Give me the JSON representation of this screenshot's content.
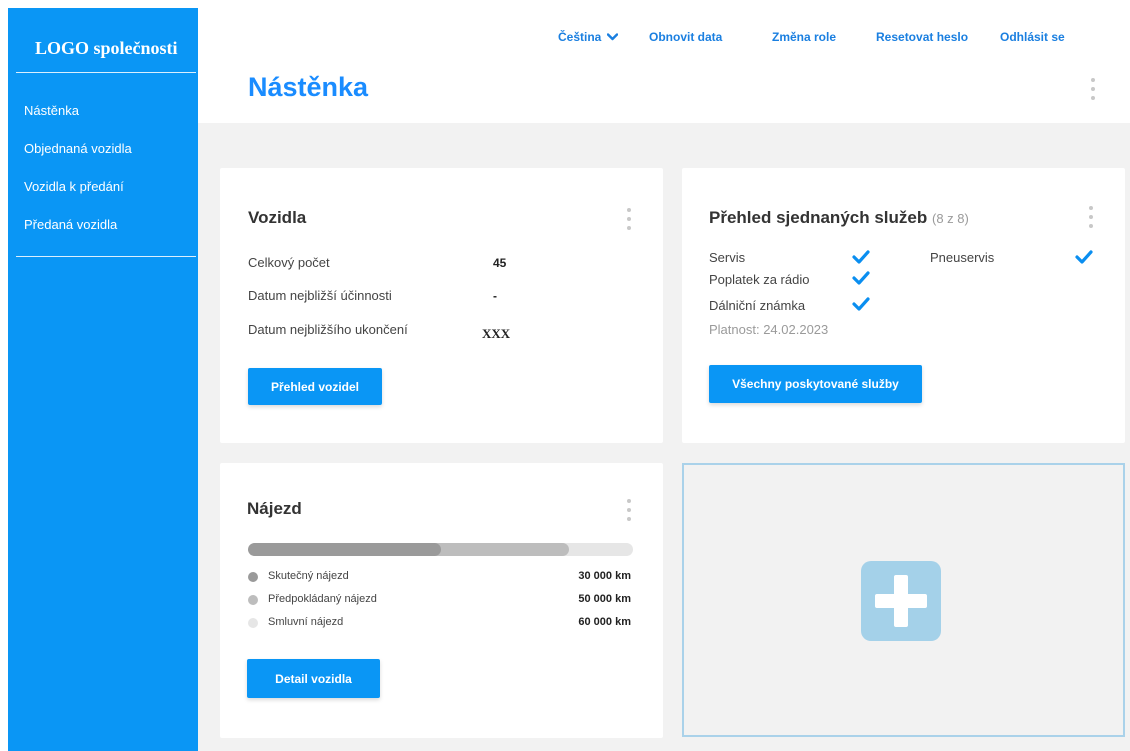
{
  "sidebar": {
    "logo": "LOGO společnosti",
    "items": [
      {
        "label": "Nástěnka"
      },
      {
        "label": "Objednaná vozidla"
      },
      {
        "label": "Vozidla k předání"
      },
      {
        "label": "Předaná vozidla"
      }
    ]
  },
  "header": {
    "language": "Čeština",
    "refresh": "Obnovit data",
    "change_role": "Změna role",
    "reset_password": "Resetovat heslo",
    "logout": "Odhlásit se"
  },
  "page": {
    "title": "Nástěnka"
  },
  "vehicles_card": {
    "title": "Vozidla",
    "rows": [
      {
        "label": "Celkový počet",
        "value": "45"
      },
      {
        "label": "Datum nejbližší účinnosti",
        "value": "-"
      },
      {
        "label": "Datum nejbližšího ukončení",
        "value": "XXX"
      }
    ],
    "button": "Přehled vozidel"
  },
  "services_card": {
    "title": "Přehled sjednaných služeb",
    "count": "(8 z 8)",
    "services": [
      {
        "label": "Servis",
        "checked": true
      },
      {
        "label": "Poplatek za rádio",
        "checked": true
      },
      {
        "label": "Dálniční známka",
        "checked": true
      },
      {
        "label": "Pneuservis",
        "checked": true
      }
    ],
    "validity": "Platnost: 24.02.2023",
    "button": "Všechny poskytované služby"
  },
  "mileage_card": {
    "title": "Nájezd",
    "progress": {
      "actual": 30000,
      "expected": 50000,
      "contract": 60000
    },
    "legend": [
      {
        "label": "Skutečný nájezd",
        "value": "30 000 km",
        "color": "#9a9a9a"
      },
      {
        "label": "Předpokládaný nájezd",
        "value": "50 000 km",
        "color": "#bdbdbd"
      },
      {
        "label": "Smluvní nájezd",
        "value": "60 000 km",
        "color": "#e6e6e6"
      }
    ],
    "button": "Detail vozidla"
  },
  "colors": {
    "accent": "#0a96f5",
    "title": "#1a8cff",
    "check": "#0a8ef0",
    "add_tile": "#a4d1e9"
  }
}
